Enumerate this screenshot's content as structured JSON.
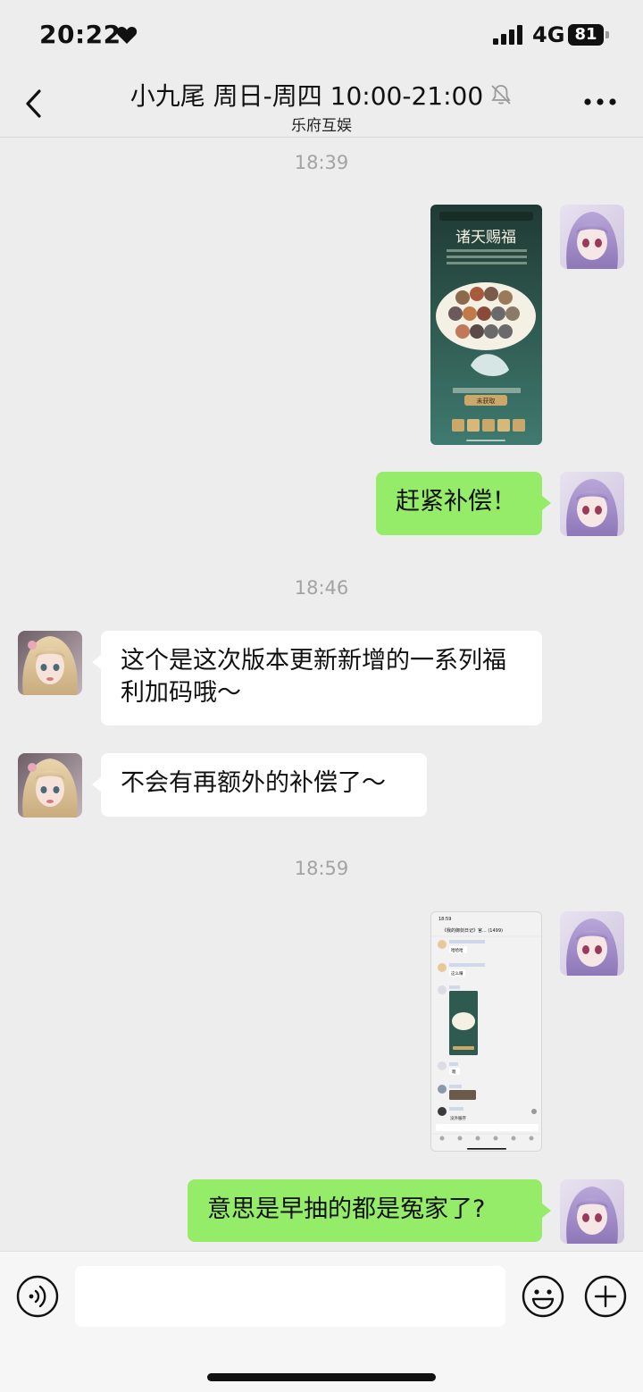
{
  "status_bar": {
    "time": "20:22",
    "network": "4G",
    "battery": "81",
    "icons": [
      "heart-icon",
      "signal-icon",
      "battery-icon"
    ]
  },
  "header": {
    "title": "小九尾 周日-周四 10:00-21:00",
    "subtitle": "乐府互娱",
    "icons": [
      "back-icon",
      "mute-bell-icon",
      "more-icon"
    ]
  },
  "messages": [
    {
      "type": "timestamp",
      "text": "18:39"
    },
    {
      "type": "image",
      "sender": "me",
      "image_title": "诸天赐福",
      "button_label": "未获取"
    },
    {
      "type": "text",
      "sender": "me",
      "text": "赶紧补偿！"
    },
    {
      "type": "timestamp",
      "text": "18:46"
    },
    {
      "type": "text",
      "sender": "them",
      "text": "这个是这次版本更新新增的一系列福利加码哦～"
    },
    {
      "type": "text",
      "sender": "them",
      "text": "不会有再额外的补偿了～"
    },
    {
      "type": "timestamp",
      "text": "18:59"
    },
    {
      "type": "image",
      "sender": "me",
      "screenshot_time": "18:59",
      "screenshot_title": "《我的御剑日记》官... (1499)",
      "lines": [
        "哈哈哈",
        "这么赚",
        "嗯",
        "没外服存"
      ]
    },
    {
      "type": "text",
      "sender": "me",
      "text": "意思是早抽的都是冤家了?"
    }
  ],
  "input_bar": {
    "placeholder": "",
    "icons": [
      "voice-icon",
      "emoji-icon",
      "plus-icon"
    ]
  },
  "colors": {
    "background": "#ededed",
    "my_bubble": "#95ec69",
    "their_bubble": "#ffffff",
    "timestamp": "#a3a3a3"
  }
}
